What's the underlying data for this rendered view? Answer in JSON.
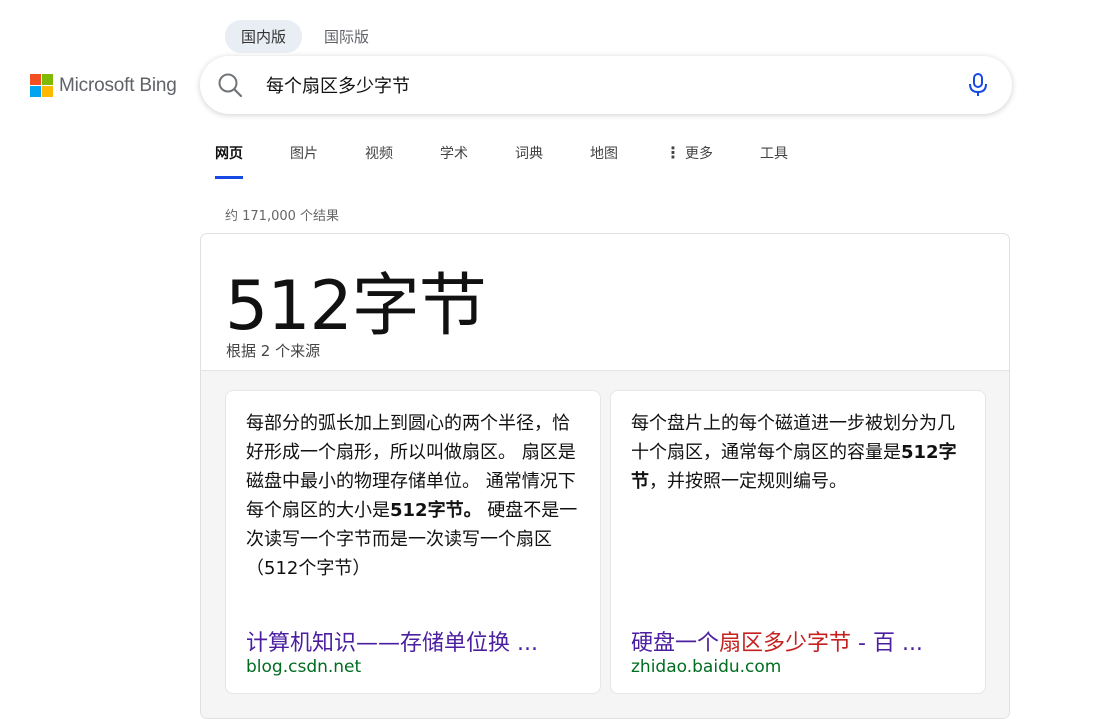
{
  "brand": {
    "name": "Microsoft Bing",
    "logo_colors": [
      "#f25022",
      "#7fba00",
      "#00a4ef",
      "#ffb900"
    ]
  },
  "region_tabs": [
    {
      "label": "国内版",
      "active": true
    },
    {
      "label": "国际版",
      "active": false
    }
  ],
  "search": {
    "query": "每个扇区多少字节",
    "search_icon": "search-icon",
    "mic_icon": "microphone-icon"
  },
  "nav": {
    "items": [
      "网页",
      "图片",
      "视频",
      "学术",
      "词典",
      "地图"
    ],
    "more_label": "更多",
    "tools_label": "工具",
    "active_index": 0
  },
  "result_count": "约 171,000 个结果",
  "answer": {
    "main": "512字节",
    "sources_note": "根据 2 个来源",
    "cards": [
      {
        "text_before": "每部分的弧长加上到圆心的两个半径，恰好形成一个扇形，所以叫做扇区。 扇区是磁盘中最小的物理存储单位。 通常情况下每个扇区的大小是",
        "bold": "512字节。",
        "text_after": " 硬盘不是一次读写一个字节而是一次读写一个扇区（512个字节）",
        "title": "计算机知识——存储单位换 ...",
        "title_highlight": "",
        "title_after": "",
        "domain": "blog.csdn.net"
      },
      {
        "text_before": "每个盘片上的每个磁道进一步被划分为几十个扇区，通常每个扇区的容量是",
        "bold": "512字节",
        "text_after": "，并按照一定规则编号。",
        "title": "硬盘一个",
        "title_highlight": "扇区多少字节",
        "title_after": " - 百 ...",
        "domain": "zhidao.baidu.com"
      }
    ]
  }
}
